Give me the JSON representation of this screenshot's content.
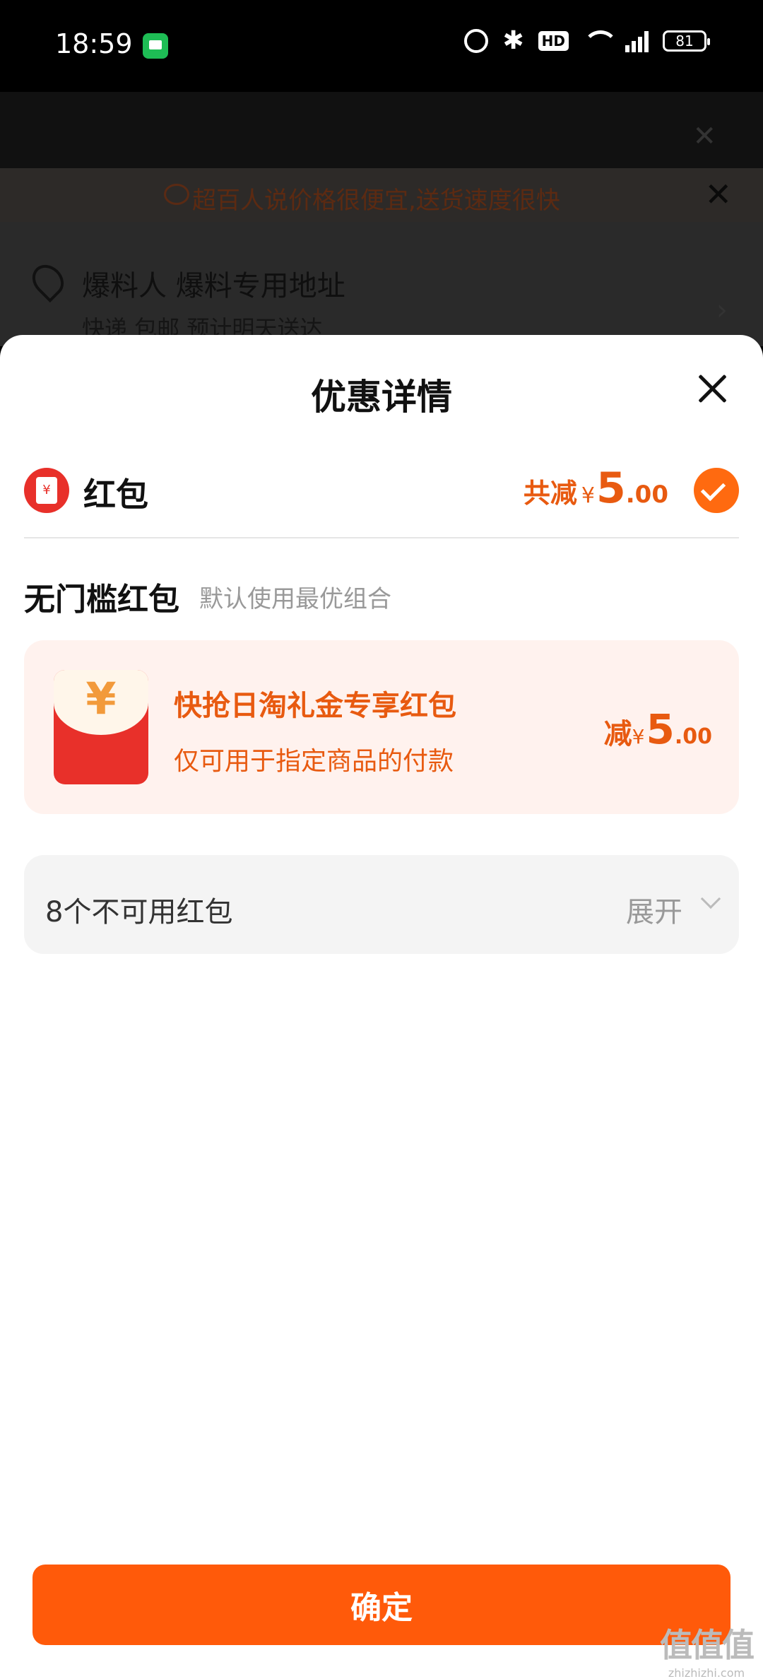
{
  "status_bar": {
    "time": "18:59",
    "icons": [
      "message-app-icon",
      "alarm-icon",
      "bluetooth-icon",
      "hd-icon",
      "wifi-icon",
      "signal-5g-icon",
      "battery-icon"
    ],
    "network": "5G",
    "hd_label": "HD",
    "battery_level": "81"
  },
  "background_page": {
    "notice_text": "超百人说价格很便宜,送货速度很快",
    "address_name": "爆料人 爆料专用地址",
    "address_sub": "快递 包邮 预计明天送达"
  },
  "sheet": {
    "title": "优惠详情",
    "hongbao_row": {
      "label": "红包",
      "total_label": "共减",
      "currency": "¥",
      "amount_int": "5",
      "amount_dec": ".00",
      "checked": true
    },
    "section": {
      "title": "无门槛红包",
      "subtitle": "默认使用最优组合"
    },
    "coupon": {
      "icon_glyph": "¥",
      "title": "快抢日淘礼金专享红包",
      "description": "仅可用于指定商品的付款",
      "amount_label": "减",
      "currency": "¥",
      "amount_int": "5",
      "amount_dec": ".00"
    },
    "unavailable": {
      "label": "8个不可用红包",
      "expand_label": "展开"
    },
    "confirm_label": "确定"
  },
  "watermark": {
    "big": "值值值",
    "small": "zhizhizhi.com"
  },
  "colors": {
    "accent_orange": "#ff5a0a",
    "text_orange": "#e85a10",
    "coupon_bg": "#fff2ee",
    "red_packet": "#e8302a"
  }
}
